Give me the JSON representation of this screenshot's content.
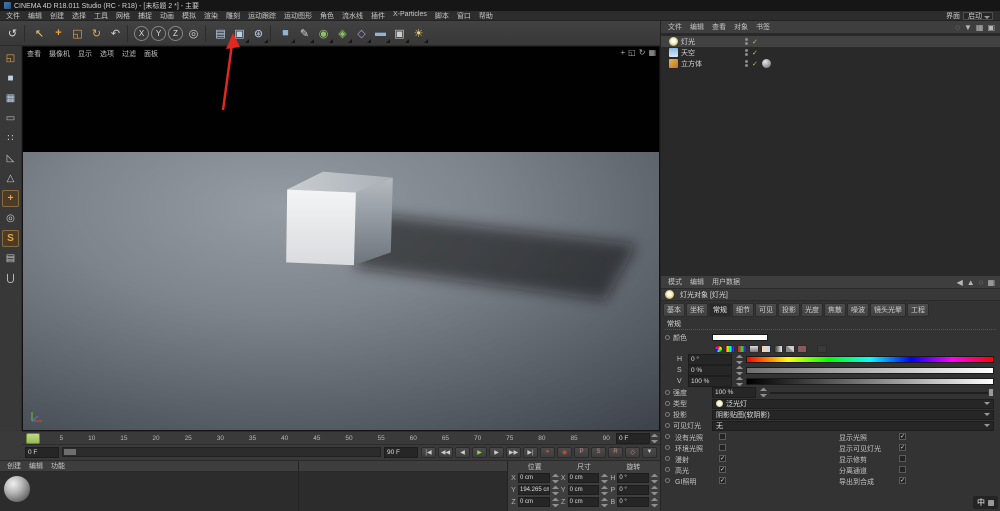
{
  "titlebar": {
    "title": "CINEMA 4D R18.011 Studio (RC - R18) - [未标题 2 *] - 主要"
  },
  "menubar": {
    "items": [
      "文件",
      "编辑",
      "创建",
      "选择",
      "工具",
      "网格",
      "捕捉",
      "动画",
      "模拟",
      "渲染",
      "雕刻",
      "运动跟踪",
      "运动图形",
      "角色",
      "流水线",
      "插件",
      "X-Particles",
      "脚本",
      "窗口",
      "帮助"
    ],
    "layout_label": "界面",
    "layout_value": "启动"
  },
  "toolbar": {
    "icons": [
      {
        "name": "undo-icon",
        "glyph": "↺",
        "style": "color:#d8d8d8"
      },
      {
        "name": "toolbar-separator",
        "sep": "1",
        "inter": "false"
      },
      {
        "name": "live-selection-icon",
        "glyph": "↖",
        "style": "color:#e8cd7a"
      },
      {
        "name": "move-icon",
        "glyph": "+",
        "style": "color:#e8a33c;font-weight:bold"
      },
      {
        "name": "scale-icon",
        "glyph": "◱",
        "style": "color:#e8a33c"
      },
      {
        "name": "rotate-icon",
        "glyph": "↻",
        "style": "color:#e8a33c"
      },
      {
        "name": "last-tool-icon",
        "glyph": "↶",
        "style": "color:#d0d0d0"
      },
      {
        "name": "toolbar-separator",
        "sep": "1",
        "inter": "false"
      },
      {
        "name": "x-axis-toggle",
        "glyph": "X",
        "circ": "1"
      },
      {
        "name": "y-axis-toggle",
        "glyph": "Y",
        "circ": "1"
      },
      {
        "name": "z-axis-toggle",
        "glyph": "Z",
        "circ": "1"
      },
      {
        "name": "coordinate-system-icon",
        "glyph": "◎",
        "style": "color:#d0d0d0"
      },
      {
        "name": "toolbar-separator",
        "sep": "1",
        "inter": "false"
      },
      {
        "name": "render-view-icon",
        "glyph": "▤",
        "style": "color:#bcd2e8"
      },
      {
        "name": "render-picture-viewer-icon",
        "glyph": "▣",
        "style": "color:#bcd2e8",
        "grp": "1"
      },
      {
        "name": "render-settings-icon",
        "glyph": "⊛",
        "style": "color:#bcd2e8",
        "grp": "1"
      },
      {
        "name": "toolbar-separator",
        "sep": "1",
        "inter": "false"
      },
      {
        "name": "primitive-cube-icon",
        "glyph": "■",
        "style": "color:#8fb3d9",
        "grp": "1"
      },
      {
        "name": "spline-pen-icon",
        "glyph": "✎",
        "style": "color:#d8d8d8",
        "grp": "1"
      },
      {
        "name": "subdivision-surface-icon",
        "glyph": "◉",
        "style": "color:#8fc066",
        "grp": "1"
      },
      {
        "name": "modeling-generator-icon",
        "glyph": "◈",
        "style": "color:#8fc066",
        "grp": "1"
      },
      {
        "name": "deformer-icon",
        "glyph": "◇",
        "style": "color:#b49ae0",
        "grp": "1"
      },
      {
        "name": "environment-floor-icon",
        "glyph": "▬",
        "style": "color:#8fb3d9",
        "grp": "1"
      },
      {
        "name": "camera-icon",
        "glyph": "▣",
        "style": "color:#cccccc",
        "grp": "1"
      },
      {
        "name": "light-tool-icon",
        "glyph": "☀",
        "style": "color:#e8d27a",
        "grp": "1"
      }
    ]
  },
  "left_toolbar": {
    "icons": [
      {
        "name": "make-editable-icon",
        "glyph": "◱",
        "style": "color:#e8a33c"
      },
      {
        "name": "model-mode-icon",
        "glyph": "■",
        "style": "color:#bcd2e8"
      },
      {
        "name": "texture-mode-icon",
        "glyph": "▦",
        "style": "color:#bcd2e8"
      },
      {
        "name": "workplane-mode-icon",
        "glyph": "▭",
        "style": "color:#bcbcbc"
      },
      {
        "name": "points-mode-icon",
        "glyph": "∷",
        "style": "color:#c8c8c8"
      },
      {
        "name": "edges-mode-icon",
        "glyph": "◺",
        "style": "color:#c8c8c8"
      },
      {
        "name": "polygons-mode-icon",
        "glyph": "△",
        "style": "color:#c8c8c8"
      },
      {
        "name": "enable-axis-icon",
        "glyph": "+",
        "style": "color:#e8a33c;font-weight:bold",
        "active": "1"
      },
      {
        "name": "solo-mode-icon",
        "glyph": "◎",
        "style": "color:#c8c8c8"
      },
      {
        "name": "snap-toggle-icon",
        "glyph": "S",
        "style": "color:#e8a33c;font-weight:bold",
        "active": "1"
      },
      {
        "name": "workplane-lock-icon",
        "glyph": "▤",
        "style": "color:#c8c8c8"
      },
      {
        "name": "magnet-snap-icon",
        "glyph": "⋃",
        "style": "color:#c8c8c8"
      }
    ]
  },
  "viewport": {
    "menu": [
      "查看",
      "摄像机",
      "显示",
      "选项",
      "过滤",
      "面板"
    ],
    "corner_icons": [
      {
        "name": "viewport-pan-icon",
        "glyph": "+"
      },
      {
        "name": "viewport-zoom-icon",
        "glyph": "◱"
      },
      {
        "name": "viewport-rotate-icon",
        "glyph": "↻"
      },
      {
        "name": "viewport-maximize-icon",
        "glyph": "▦"
      }
    ]
  },
  "timeline": {
    "ticks": [
      "0",
      "5",
      "10",
      "15",
      "20",
      "25",
      "30",
      "35",
      "40",
      "45",
      "50",
      "55",
      "60",
      "65",
      "70",
      "75",
      "80",
      "85",
      "90"
    ],
    "current_frame": "0 F"
  },
  "transport": {
    "range_start": "0 F",
    "range_end": "90 F",
    "buttons": [
      {
        "name": "goto-start-button",
        "glyph": "|◀"
      },
      {
        "name": "prev-key-button",
        "glyph": "◀◀"
      },
      {
        "name": "prev-frame-button",
        "glyph": "◀"
      },
      {
        "name": "play-button",
        "glyph": "▶",
        "tone": "green"
      },
      {
        "name": "next-frame-button",
        "glyph": "▶"
      },
      {
        "name": "next-key-button",
        "glyph": "▶▶"
      },
      {
        "name": "goto-end-button",
        "glyph": "▶|"
      },
      {
        "name": "record-keyframe-button",
        "glyph": "●",
        "tone": "red"
      },
      {
        "name": "autokey-button",
        "glyph": "◉",
        "tone": "red"
      },
      {
        "name": "record-position-button",
        "glyph": "P",
        "tone": "dim"
      },
      {
        "name": "record-scale-button",
        "glyph": "S",
        "tone": "dim"
      },
      {
        "name": "record-rotation-button",
        "glyph": "R",
        "tone": "dim"
      },
      {
        "name": "record-parameter-button",
        "glyph": "◇",
        "tone": "dim"
      },
      {
        "name": "keying-settings-button",
        "glyph": "▼"
      }
    ]
  },
  "materials": {
    "tabs": [
      "创建",
      "编辑",
      "功能"
    ]
  },
  "coordinates": {
    "headers": [
      "位置",
      "尺寸",
      "旋转"
    ],
    "rows": [
      {
        "p_l": "X",
        "p_v": "0 cm",
        "s_l": "X",
        "s_v": "0 cm",
        "r_l": "H",
        "r_v": "0 °"
      },
      {
        "p_l": "Y",
        "p_v": "194.265 cm",
        "s_l": "Y",
        "s_v": "0 cm",
        "r_l": "P",
        "r_v": "0 °"
      },
      {
        "p_l": "Z",
        "p_v": "0 cm",
        "s_l": "Z",
        "s_v": "0 cm",
        "r_l": "B",
        "r_v": "0 °"
      }
    ]
  },
  "object_manager": {
    "menu": [
      "文件",
      "编辑",
      "查看",
      "对象",
      "书签"
    ],
    "icons": [
      {
        "name": "om-search-icon",
        "glyph": "◌"
      },
      {
        "name": "om-filter-icon",
        "glyph": "▼"
      },
      {
        "name": "om-path-icon",
        "glyph": "▦"
      },
      {
        "name": "om-lock-icon",
        "glyph": "▣"
      }
    ],
    "objects": [
      {
        "name": "灯光",
        "icon": "light",
        "selected": "1",
        "check": "✓"
      },
      {
        "name": "天空",
        "icon": "sky",
        "check": "✓"
      },
      {
        "name": "立方体",
        "icon": "cube",
        "check": "✓",
        "tag": "phong"
      }
    ]
  },
  "attribute_manager": {
    "menu": [
      "模式",
      "编辑",
      "用户数据"
    ],
    "icons": [
      {
        "name": "am-back-icon",
        "glyph": "◀"
      },
      {
        "name": "am-lock-icon",
        "glyph": "▲"
      },
      {
        "name": "am-search-icon",
        "glyph": "◌"
      },
      {
        "name": "am-layout-icon",
        "glyph": "▦"
      }
    ],
    "object_title": "灯光对象 [灯光]",
    "tabs": [
      {
        "label": "基本"
      },
      {
        "label": "坐标"
      },
      {
        "label": "常规",
        "active": "1"
      },
      {
        "label": "细节"
      },
      {
        "label": "可见"
      },
      {
        "label": "投影"
      },
      {
        "label": "光度"
      },
      {
        "label": "焦散"
      },
      {
        "label": "噪波"
      },
      {
        "label": "镜头光晕"
      },
      {
        "label": "工程"
      }
    ],
    "section": "常规",
    "color": {
      "label": "颜色",
      "hex": "#ffffff"
    },
    "mode_icons": [
      {
        "name": "color-wheel-icon",
        "kind": "wheel"
      },
      {
        "name": "color-spectrum-icon",
        "kind": "spectrum"
      },
      {
        "name": "color-rgb-icon",
        "kind": "rgb"
      },
      {
        "name": "color-hsv-icon",
        "kind": "hsv"
      },
      {
        "name": "color-kelvin-icon",
        "kind": "kelvin"
      },
      {
        "name": "color-brightness-icon",
        "kind": "bright"
      },
      {
        "name": "color-mixer-icon",
        "kind": "mix"
      },
      {
        "name": "color-swatches-icon",
        "kind": "swatch"
      },
      {
        "name": "color-picker-icon",
        "kind": "picker"
      }
    ],
    "hsv": [
      {
        "label": "H",
        "value": "0 °",
        "bar": "hue"
      },
      {
        "label": "S",
        "value": "0 %",
        "bar": "sat"
      },
      {
        "label": "V",
        "value": "100 %",
        "bar": "val"
      }
    ],
    "intensity": {
      "label": "强度",
      "value": "100 %"
    },
    "fields": [
      {
        "label": "类型",
        "value": "泛光灯",
        "icon": "light"
      },
      {
        "label": "投影",
        "value": "阴影贴图(软阴影)"
      },
      {
        "label": "可见灯光",
        "value": "无"
      }
    ],
    "checkboxes": [
      {
        "l1": "没有光照",
        "c1": "",
        "l2": "显示光照",
        "c2": "✓"
      },
      {
        "l1": "环境光照",
        "c1": "",
        "l2": "显示可见灯光",
        "c2": "✓"
      },
      {
        "l1": "漫射",
        "c1": "✓",
        "l2": "显示修剪",
        "c2": ""
      },
      {
        "l1": "高光",
        "c1": "✓",
        "l2": "分离通道",
        "c2": ""
      },
      {
        "l1": "GI照明",
        "c1": "✓",
        "l2": "导出到合成",
        "c2": "✓"
      }
    ]
  },
  "status": {
    "ime": "中"
  },
  "colors": {
    "accent_orange": "#e8a33c",
    "play_green": "#8fd34a",
    "record_red": "#d04a3a",
    "check_green": "#9fcf4a",
    "arrow_red": "#e02820",
    "viewport_floor": "#7e848c"
  }
}
